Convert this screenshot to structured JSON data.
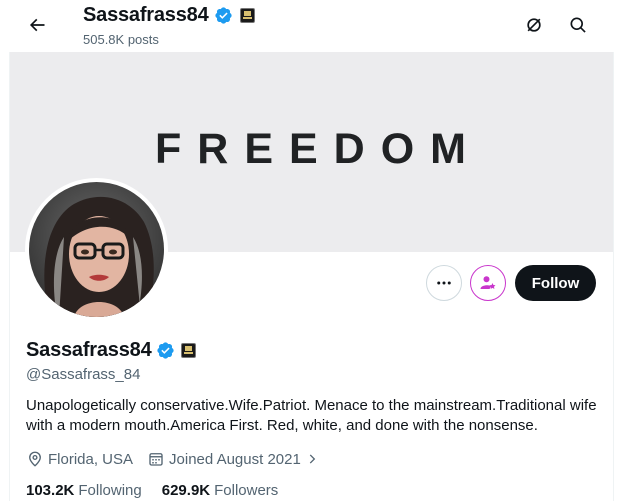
{
  "header": {
    "title": "Sassafrass84",
    "posts_count": "505.8K posts"
  },
  "banner": {
    "text": "FREEDOM",
    "background": "#ececee"
  },
  "profile": {
    "display_name": "Sassafrass84",
    "handle": "@Sassafrass_84",
    "bio": "Unapologetically conservative.Wife.Patriot. Menace to the mainstream.Traditional wife with a modern mouth.America First. Red, white, and done with the nonsense.",
    "location": "Florida, USA",
    "joined": "Joined August 2021",
    "following_count": "103.2K",
    "following_label": "Following",
    "followers_count": "629.9K",
    "followers_label": "Followers"
  },
  "actions": {
    "follow_label": "Follow"
  },
  "icons": {
    "back": "arrow-left-icon",
    "no_grok": "circle-slash-icon",
    "search": "search-icon",
    "more": "more-horizontal-icon",
    "subscribe": "person-star-icon",
    "location": "location-pin-icon",
    "calendar": "calendar-icon",
    "verified": "verified-badge-icon"
  },
  "colors": {
    "text_primary": "#0f1419",
    "text_secondary": "#536471",
    "verified_blue": "#1d9bf0",
    "subscribe_purple": "#c936cc",
    "follow_button_bg": "#0f1419",
    "border": "#cfd9de"
  }
}
